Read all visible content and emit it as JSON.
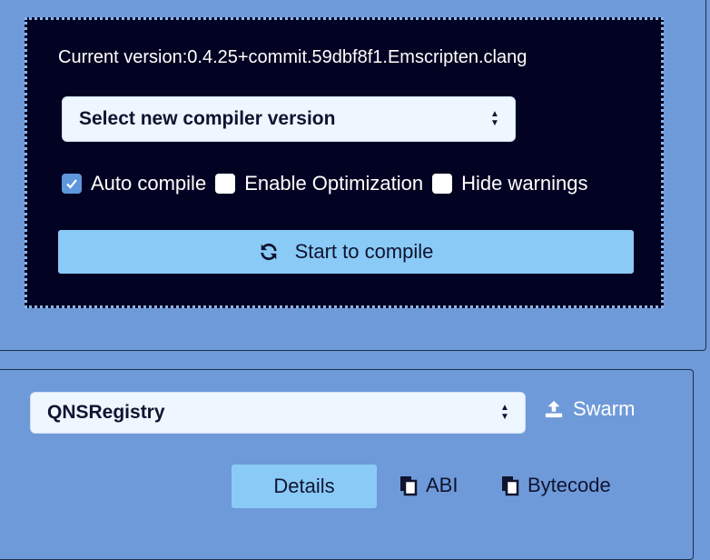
{
  "compiler": {
    "current_version": "Current version:0.4.25+commit.59dbf8f1.Emscripten.clang",
    "select_label": "Select new compiler version",
    "options": {
      "auto_compile": {
        "label": "Auto compile",
        "checked": true
      },
      "enable_optimization": {
        "label": "Enable Optimization",
        "checked": false
      },
      "hide_warnings": {
        "label": "Hide warnings",
        "checked": false
      }
    },
    "compile_button": "Start to compile"
  },
  "contract": {
    "selected": "QNSRegistry",
    "swarm_label": "Swarm",
    "details_button": "Details",
    "abi_label": "ABI",
    "bytecode_label": "Bytecode"
  },
  "icons": {
    "refresh": "refresh-icon",
    "upload": "upload-icon",
    "copy": "copy-icon",
    "check": "check-icon",
    "select_arrows": "select-arrows-icon"
  },
  "colors": {
    "panel_bg": "#6e9ad9",
    "compiler_box_bg": "#020322",
    "button_bg": "#8acaf7",
    "checkbox_checked": "#5f97dd"
  }
}
